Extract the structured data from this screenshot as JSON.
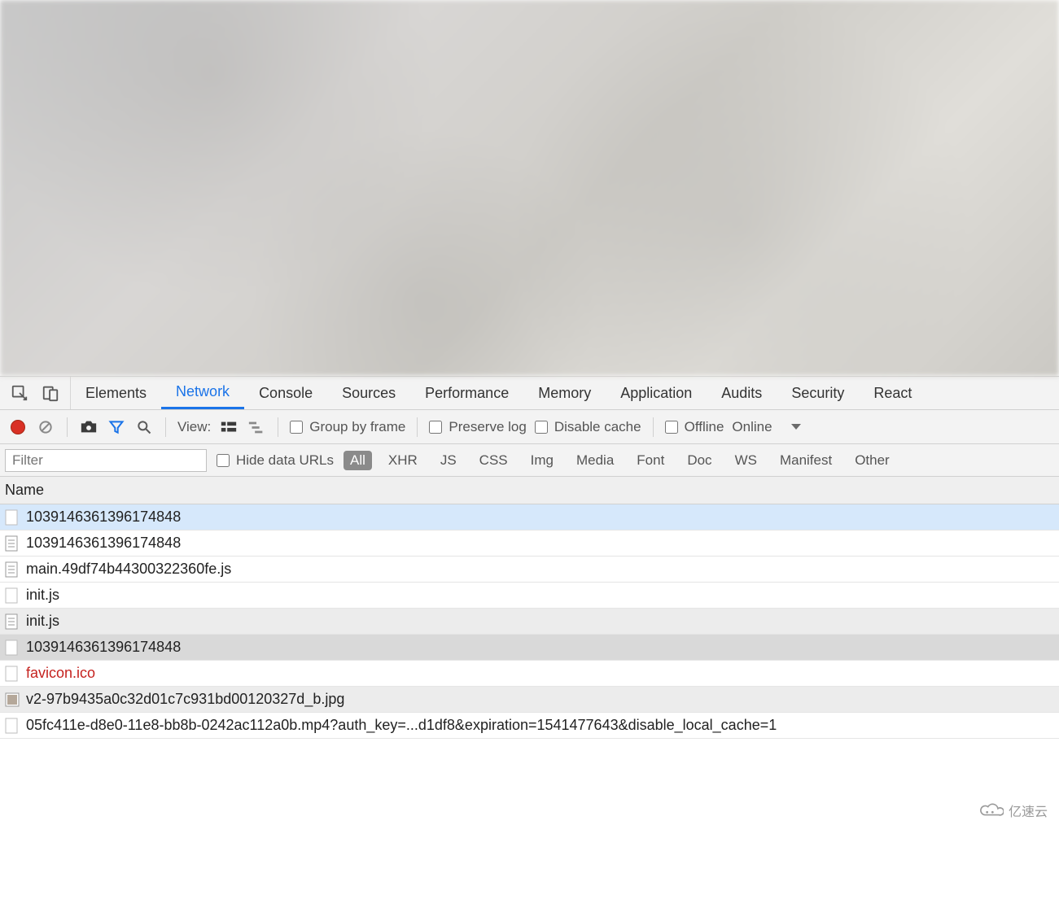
{
  "tabs": {
    "items": [
      {
        "label": "Elements"
      },
      {
        "label": "Network"
      },
      {
        "label": "Console"
      },
      {
        "label": "Sources"
      },
      {
        "label": "Performance"
      },
      {
        "label": "Memory"
      },
      {
        "label": "Application"
      },
      {
        "label": "Audits"
      },
      {
        "label": "Security"
      },
      {
        "label": "React"
      }
    ],
    "active_index": 1
  },
  "toolbar": {
    "view_label": "View:",
    "group_by_frame": "Group by frame",
    "preserve_log": "Preserve log",
    "disable_cache": "Disable cache",
    "offline": "Offline",
    "online_selected": "Online"
  },
  "filter": {
    "placeholder": "Filter",
    "value": "",
    "hide_data_urls": "Hide data URLs",
    "types": [
      "All",
      "XHR",
      "JS",
      "CSS",
      "Img",
      "Media",
      "Font",
      "Doc",
      "WS",
      "Manifest",
      "Other"
    ],
    "active_type_index": 0
  },
  "table": {
    "column_name": "Name",
    "rows": [
      {
        "name": "1039146361396174848",
        "icon": "blank",
        "selected": true
      },
      {
        "name": "1039146361396174848",
        "icon": "doc"
      },
      {
        "name": "main.49df74b44300322360fe.js",
        "icon": "doc"
      },
      {
        "name": "init.js",
        "icon": "blank"
      },
      {
        "name": "init.js",
        "icon": "doc",
        "stripe": "dark"
      },
      {
        "name": "1039146361396174848",
        "icon": "blank",
        "stripe": "dark2"
      },
      {
        "name": "favicon.ico",
        "icon": "blank",
        "error": true
      },
      {
        "name": "v2-97b9435a0c32d01c7c931bd00120327d_b.jpg",
        "icon": "img",
        "stripe": "dark"
      },
      {
        "name": "05fc411e-d8e0-11e8-bb8b-0242ac112a0b.mp4?auth_key=...d1df8&expiration=1541477643&disable_local_cache=1",
        "icon": "blank"
      }
    ]
  },
  "watermark": {
    "text": "亿速云"
  }
}
